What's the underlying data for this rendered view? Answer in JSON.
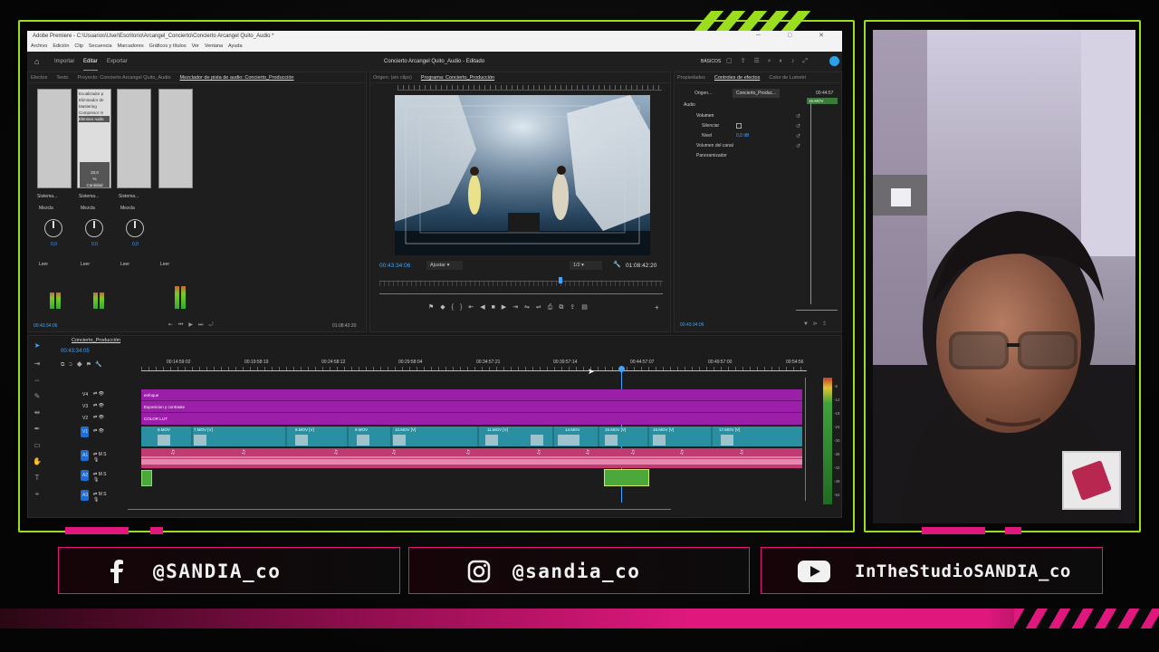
{
  "window": {
    "title": "Adobe Premiere - C:\\Usuarios\\User\\Escritorio\\Arcangel_Concierto\\Concierto Arcangel Quito_Audio *"
  },
  "menu": [
    "Archivo",
    "Edición",
    "Clip",
    "Secuencia",
    "Marcadores",
    "Gráficos y títulos",
    "Ver",
    "Ventana",
    "Ayuda"
  ],
  "workspace": {
    "tabs": [
      "Importar",
      "Editar",
      "Exportar"
    ],
    "active": "Editar",
    "project_title": "Concierto Arcangel Quito_Audio - Editado",
    "preset": "BÁSICOS"
  },
  "mixer_panel": {
    "tabs": [
      "Efectos",
      "Texto",
      "Proyecto: Concierto Arcangel Quito_Audio",
      "Mezclador de pista de audio: Concierto_Producción"
    ],
    "effect_list": [
      "Ecualizador p",
      "Eliminador de",
      "Mastering",
      "Compresor m",
      "Eliminar ruido"
    ],
    "strip_values": [
      "20,0",
      "%",
      "Cantidad"
    ],
    "channels": [
      {
        "route": "Sistema...",
        "mode": "Mezcla",
        "level": "0,0",
        "auto": "Leer"
      },
      {
        "route": "Sistema...",
        "mode": "Mezcla",
        "level": "0,0",
        "auto": "Leer"
      },
      {
        "route": "Sistema...",
        "mode": "Mezcla",
        "level": "0,0",
        "auto": "Leer"
      },
      {
        "route": "",
        "mode": "",
        "level": "",
        "auto": "Leer"
      }
    ],
    "timecode_left": "00:43:34:06",
    "timecode_right": "01:08:42:20"
  },
  "monitor": {
    "tabs": [
      "Origen: (sin clips)",
      "Programa: Concierto_Producción"
    ],
    "timecode": "00:43:34:06",
    "fit": "Ajustar",
    "res": "1/2",
    "duration": "01:08:42:20"
  },
  "effects_panel": {
    "tabs": [
      "Propiedades",
      "Controles de efectos",
      "Color de Lumetri"
    ],
    "source": "Origen...",
    "sequence": "Concierto_Produc...",
    "clip_time": "00:44:57",
    "clip_name": "15.MOV",
    "section": "Audio",
    "rows": [
      "Volumen",
      "Silenciar",
      "Nivel",
      "Volumen del canal",
      "Panoramizador"
    ],
    "level_value": "0,0 dB",
    "timecode": "00:43:34:06"
  },
  "timeline": {
    "tab": "Concierto_Producción",
    "timecode": "00:43:34:05",
    "ruler": [
      "00:14:59:02",
      "00:19:58:19",
      "00:24:58:12",
      "00:29:58:04",
      "00:34:57:21",
      "00:39:57:14",
      "00:44:57:07",
      "00:49:57:00",
      "00:54:56"
    ],
    "video_tracks": [
      {
        "id": "V4",
        "clip": "enfoque"
      },
      {
        "id": "V3",
        "clip": "Exposicion y contraste"
      },
      {
        "id": "V2",
        "clip": "COLOR LUT"
      },
      {
        "id": "V1",
        "clip": ""
      }
    ],
    "v1_clips": [
      "6.MOV",
      "7.MOV [V]",
      "8.MOV [V]",
      "9.MOV",
      "10.MOV [V]",
      "11.MOV [V]",
      "14.MOV",
      "15.MOV [V]",
      "16.MOV [V]",
      "17.MOV [V]"
    ],
    "audio_tracks": [
      "A1",
      "A2",
      "A3"
    ],
    "meter_scale": [
      "-6",
      "-12",
      "-18",
      "-24",
      "-30",
      "-36",
      "-42",
      "-48",
      "-54"
    ]
  },
  "socials": [
    {
      "icon": "facebook-icon",
      "handle": "@SANDIA_co"
    },
    {
      "icon": "instagram-icon",
      "handle": "@sandia_co"
    },
    {
      "icon": "youtube-icon",
      "handle": "InTheStudioSANDIA_co"
    }
  ],
  "colors": {
    "neon_green": "#9bde1e",
    "magenta": "#e0187e",
    "premiere_blue": "#3fa3ff",
    "adjust_purple": "#9b1fa8",
    "video_teal": "#2a8fa0",
    "audio_pink": "#d2477e"
  }
}
